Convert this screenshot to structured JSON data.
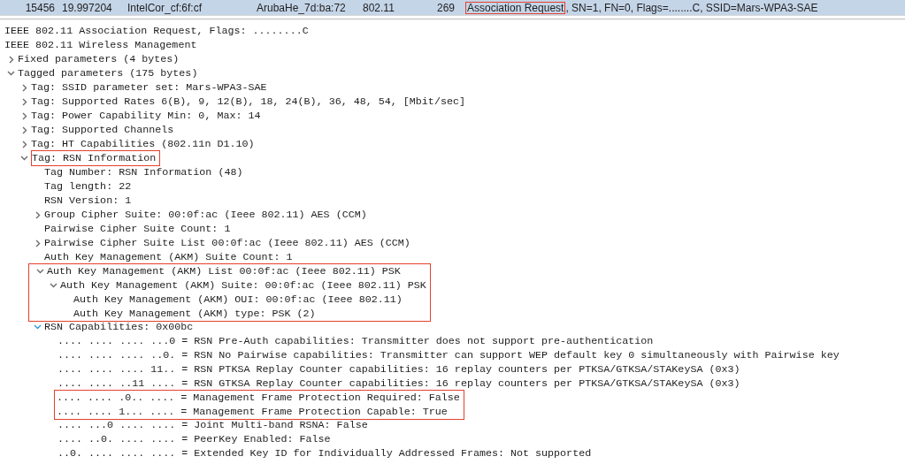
{
  "packet_row": {
    "selected": true,
    "number": "15456",
    "time": "19.997204",
    "source": "IntelCor_cf:6f:cf",
    "destination": "ArubaHe_7d:ba:72",
    "protocol": "802.11",
    "length": "269",
    "info": [
      {
        "text": "Association Request",
        "highlighted": true
      },
      {
        "text": ", SN=1, FN=0, Flags=........C, SSID=Mars-WPA3-SAE",
        "highlighted": false
      }
    ]
  },
  "summary_lines": [
    "IEEE 802.11 Association Request, Flags: ........C",
    "IEEE 802.11 Wireless Management"
  ],
  "tree": [
    {
      "text": "Fixed parameters (4 bytes)",
      "expanded": false
    },
    {
      "text": "Tagged parameters (175 bytes)",
      "expanded": true,
      "children": [
        {
          "text": "Tag: SSID parameter set: Mars-WPA3-SAE",
          "expanded": false
        },
        {
          "text": "Tag: Supported Rates 6(B), 9, 12(B), 18, 24(B), 36, 48, 54, [Mbit/sec]",
          "expanded": false
        },
        {
          "text": "Tag: Power Capability Min: 0, Max: 14",
          "expanded": false
        },
        {
          "text": "Tag: Supported Channels",
          "expanded": false
        },
        {
          "text": "Tag: HT Capabilities (802.11n D1.10)",
          "expanded": false
        },
        {
          "text": "Tag: RSN Information",
          "expanded": true,
          "highlighted": true,
          "children": [
            {
              "text": "Tag Number: RSN Information (48)"
            },
            {
              "text": "Tag length: 22"
            },
            {
              "text": "RSN Version: 1"
            },
            {
              "text": "Group Cipher Suite: 00:0f:ac (Ieee 802.11) AES (CCM)",
              "expanded": false
            },
            {
              "text": "Pairwise Cipher Suite Count: 1"
            },
            {
              "text": "Pairwise Cipher Suite List 00:0f:ac (Ieee 802.11) AES (CCM)",
              "expanded": false
            },
            {
              "text": "Auth Key Management (AKM) Suite Count: 1"
            },
            {
              "text": "Auth Key Management (AKM) List 00:0f:ac (Ieee 802.11) PSK",
              "expanded": true,
              "highlighted": true,
              "children": [
                {
                  "text": "Auth Key Management (AKM) Suite: 00:0f:ac (Ieee 802.11) PSK",
                  "expanded": true,
                  "highlighted": true,
                  "children": [
                    {
                      "text": "Auth Key Management (AKM) OUI: 00:0f:ac (Ieee 802.11)",
                      "highlighted": true
                    },
                    {
                      "text": "Auth Key Management (AKM) type: PSK (2)",
                      "highlighted": true
                    }
                  ]
                }
              ]
            },
            {
              "text": "RSN Capabilities: 0x00bc",
              "expanded": true,
              "hovered": true,
              "children": [
                {
                  "text": ".... .... .... ...0 = RSN Pre-Auth capabilities: Transmitter does not support pre-authentication"
                },
                {
                  "text": ".... .... .... ..0. = RSN No Pairwise capabilities: Transmitter can support WEP default key 0 simultaneously with Pairwise key"
                },
                {
                  "text": ".... .... .... 11.. = RSN PTKSA Replay Counter capabilities: 16 replay counters per PTKSA/GTKSA/STAKeySA (0x3)"
                },
                {
                  "text": ".... .... ..11 .... = RSN GTKSA Replay Counter capabilities: 16 replay counters per PTKSA/GTKSA/STAKeySA (0x3)"
                },
                {
                  "text": ".... .... .0.. .... = Management Frame Protection Required: False",
                  "highlighted": true
                },
                {
                  "text": ".... .... 1... .... = Management Frame Protection Capable: True",
                  "highlighted": true
                },
                {
                  "text": ".... ...0 .... .... = Joint Multi-band RSNA: False"
                },
                {
                  "text": ".... ..0. .... .... = PeerKey Enabled: False"
                },
                {
                  "text": "..0. .... .... .... = Extended Key ID for Individually Addressed Frames: Not supported"
                }
              ]
            }
          ]
        }
      ]
    }
  ]
}
